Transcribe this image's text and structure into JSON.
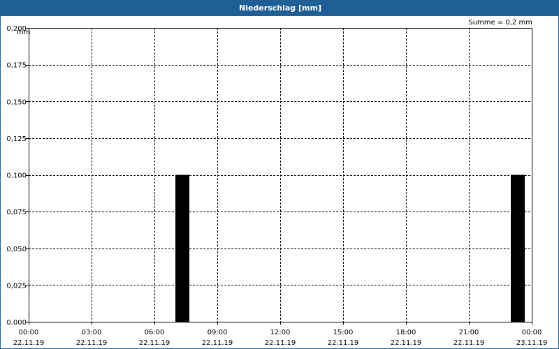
{
  "window": {
    "title": "Niederschlag [mm]"
  },
  "summary": "Summe = 0,2 mm",
  "colors": {
    "title_bar": "#1f5f95",
    "bar": "#000000",
    "grid": "#000000"
  },
  "chart_data": {
    "type": "bar",
    "title": "Niederschlag [mm]",
    "ylabel": "mm",
    "xlabel": "",
    "ylim": [
      0,
      0.2
    ],
    "yticks": [
      {
        "value": 0,
        "label": "0,000"
      },
      {
        "value": 0.025,
        "label": "0,025"
      },
      {
        "value": 0.05,
        "label": "0,050"
      },
      {
        "value": 0.075,
        "label": "0,075"
      },
      {
        "value": 0.1,
        "label": "0,100"
      },
      {
        "value": 0.125,
        "label": "0,125"
      },
      {
        "value": 0.15,
        "label": "0,150"
      },
      {
        "value": 0.175,
        "label": "0,175"
      },
      {
        "value": 0.2,
        "label": "0,200"
      }
    ],
    "xlim": [
      "2019-11-22T00:00",
      "2019-11-23T00:00"
    ],
    "xticks": [
      {
        "value": "2019-11-22T00:00",
        "time": "00:00",
        "date": "22.11.19"
      },
      {
        "value": "2019-11-22T03:00",
        "time": "03:00",
        "date": "22.11.19"
      },
      {
        "value": "2019-11-22T06:00",
        "time": "06:00",
        "date": "22.11.19"
      },
      {
        "value": "2019-11-22T09:00",
        "time": "09:00",
        "date": "22.11.19"
      },
      {
        "value": "2019-11-22T12:00",
        "time": "12:00",
        "date": "22.11.19"
      },
      {
        "value": "2019-11-22T15:00",
        "time": "15:00",
        "date": "22.11.19"
      },
      {
        "value": "2019-11-22T18:00",
        "time": "18:00",
        "date": "22.11.19"
      },
      {
        "value": "2019-11-22T21:00",
        "time": "21:00",
        "date": "22.11.19"
      },
      {
        "value": "2019-11-23T00:00",
        "time": "00:00",
        "date": "23.11.19"
      }
    ],
    "bars": [
      {
        "start": "2019-11-22T07:00",
        "end": "2019-11-22T07:40",
        "value": 0.1
      },
      {
        "start": "2019-11-22T23:00",
        "end": "2019-11-22T23:40",
        "value": 0.1
      }
    ],
    "grid": true,
    "legend": "none"
  }
}
